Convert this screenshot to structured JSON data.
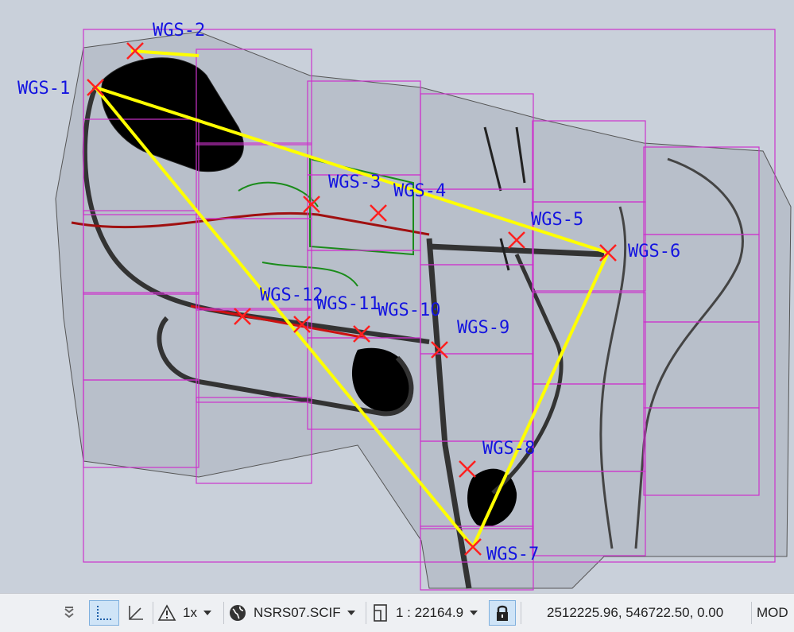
{
  "drawing": {
    "points": [
      {
        "label": "WGS-1"
      },
      {
        "label": "WGS-2"
      },
      {
        "label": "WGS-3"
      },
      {
        "label": "WGS-4"
      },
      {
        "label": "WGS-5"
      },
      {
        "label": "WGS-6"
      },
      {
        "label": "WGS-7"
      },
      {
        "label": "WGS-8"
      },
      {
        "label": "WGS-9"
      },
      {
        "label": "WGS-10"
      },
      {
        "label": "WGS-11"
      },
      {
        "label": "WGS-12"
      }
    ],
    "colors": {
      "background": "#c9d0da",
      "sheet_frames": "#cc33cc",
      "survey_triangle": "#ffff00",
      "markers": "#ff2020",
      "labels": "#1414e0",
      "features": "#000000"
    }
  },
  "statusbar": {
    "scale_factor": "1x",
    "coordinate_system": "NSRS07.SCIF",
    "annotation_scale": "1 : 22164.9",
    "coordinates": "2512225.96, 546722.50, 0.00",
    "mode": "MOD",
    "icons": {
      "menu": "chevron-menu-icon",
      "ortho": "ortho-icon",
      "ucs": "ucs-icon",
      "warning": "warning-icon",
      "globe": "globe-icon",
      "layout": "layout-icon",
      "lock": "lock-icon"
    }
  }
}
